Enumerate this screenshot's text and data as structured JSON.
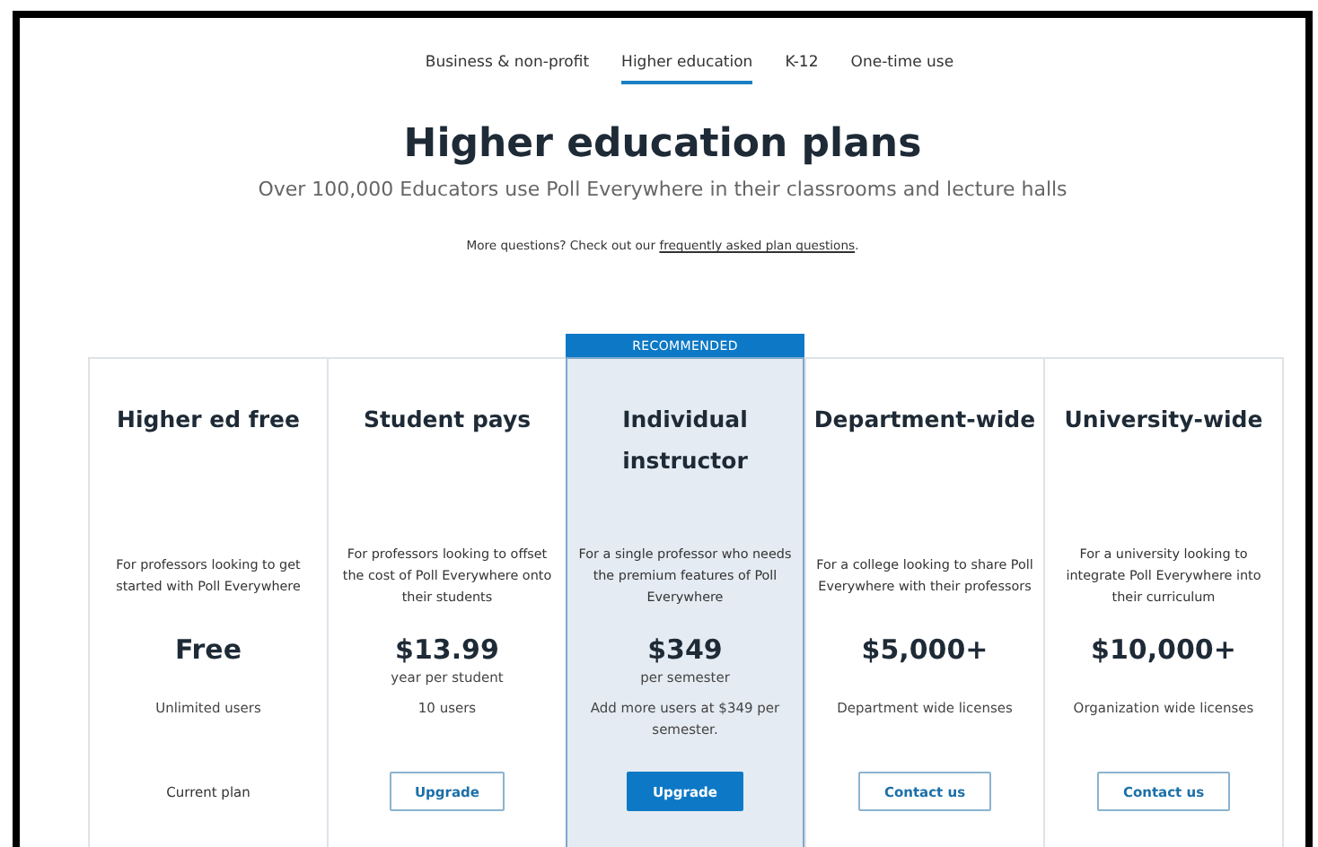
{
  "tabs": [
    {
      "label": "Business & non-profit",
      "selected": false
    },
    {
      "label": "Higher education",
      "selected": true
    },
    {
      "label": "K-12",
      "selected": false
    },
    {
      "label": "One-time use",
      "selected": false
    }
  ],
  "heading": "Higher education plans",
  "subtitle": "Over 100,000 Educators use Poll Everywhere in their classrooms and lecture halls",
  "note": {
    "text": "More questions? Check out our ",
    "link": "frequently asked plan questions",
    "end": "."
  },
  "plans": [
    {
      "name": "Higher ed free",
      "recommended": false,
      "description": "For professors looking to get started with Poll Everywhere",
      "price": "Free",
      "users": "Unlimited users",
      "action": {
        "kind": "text",
        "label": "Current plan"
      }
    },
    {
      "name": "Student pays",
      "recommended": false,
      "description": "For professors looking to offset the cost of Poll Everywhere onto their students",
      "price": "$13.99",
      "period": "year per student",
      "users": "10 users",
      "action": {
        "kind": "outline",
        "label": "Upgrade"
      }
    },
    {
      "name": "Individual instructor",
      "recommended": true,
      "badge": "RECOMMENDED",
      "description": "For a single professor who needs the premium features of Poll Everywhere",
      "price": "$349",
      "period": "per semester",
      "users": "Add more users at $349 per semester.",
      "action": {
        "kind": "filled",
        "label": "Upgrade"
      }
    },
    {
      "name": "Department-wide",
      "recommended": false,
      "description": "For a college looking to share Poll Everywhere with their professors",
      "price": "$5,000+",
      "users": "Department wide licenses",
      "action": {
        "kind": "outline",
        "label": "Contact us"
      }
    },
    {
      "name": "University-wide",
      "recommended": false,
      "description": "For a university looking to integrate Poll Everywhere into their curriculum",
      "price": "$10,000+",
      "users": "Organization wide licenses",
      "action": {
        "kind": "outline",
        "label": "Contact us"
      }
    }
  ]
}
